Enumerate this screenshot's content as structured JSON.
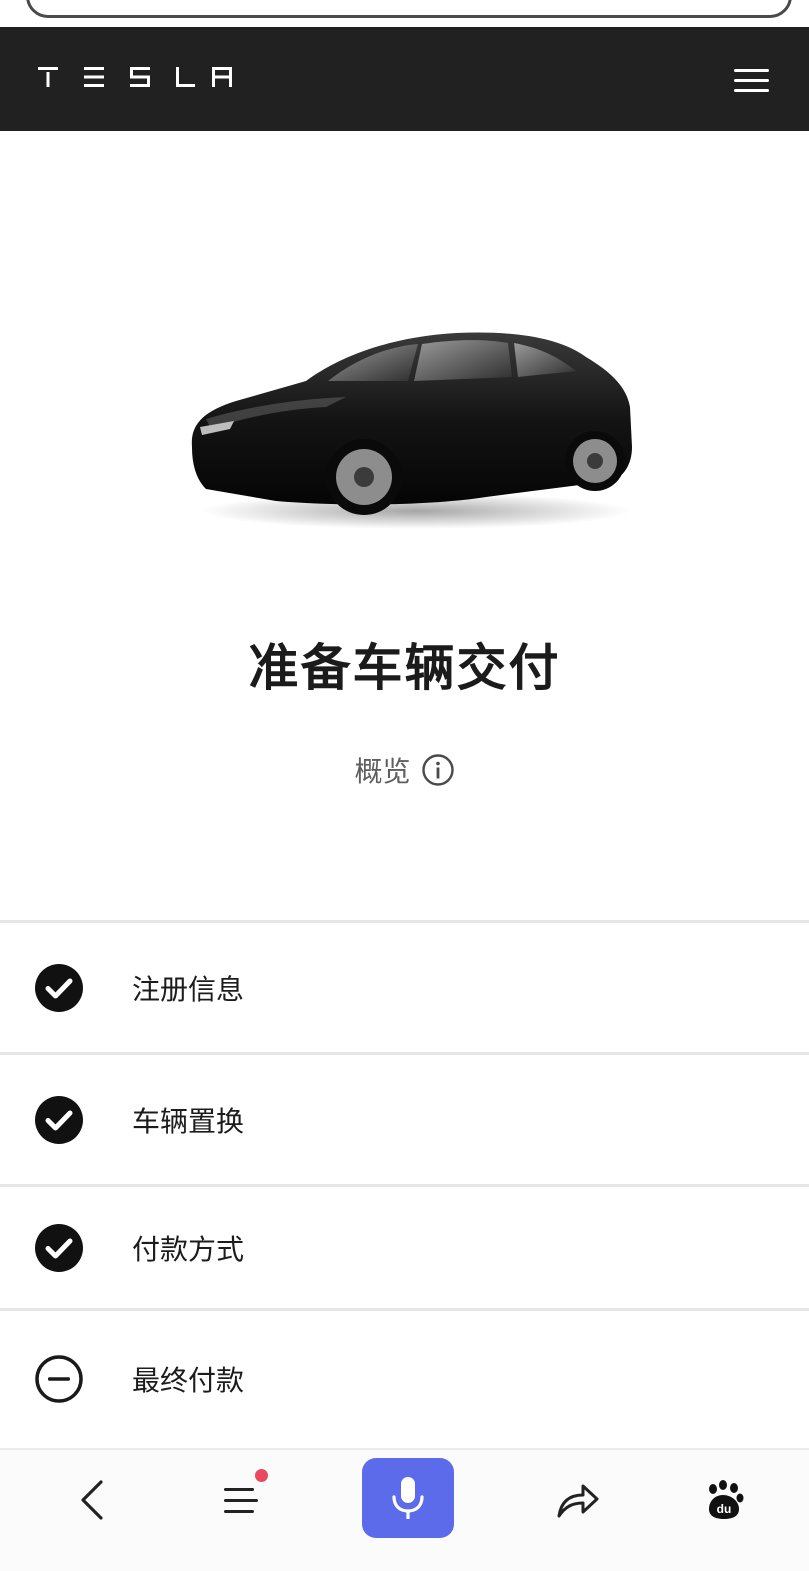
{
  "header": {
    "brand": "TESLA",
    "menu_icon": "hamburger-menu-icon"
  },
  "hero": {
    "vehicle_image": "Model Y black",
    "title": "准备车辆交付",
    "overview_label": "概览",
    "overview_icon": "info-icon"
  },
  "steps": [
    {
      "label": "注册信息",
      "status": "completed",
      "icon": "check-circle-icon"
    },
    {
      "label": "车辆置换",
      "status": "completed",
      "icon": "check-circle-icon"
    },
    {
      "label": "付款方式",
      "status": "completed",
      "icon": "check-circle-icon"
    },
    {
      "label": "最终付款",
      "status": "pending",
      "icon": "minus-circle-icon"
    }
  ],
  "browser_nav": {
    "items": [
      {
        "name": "back",
        "icon": "chevron-left-icon"
      },
      {
        "name": "tabs",
        "icon": "menu-lines-icon",
        "has_notification": true
      },
      {
        "name": "voice",
        "icon": "microphone-icon"
      },
      {
        "name": "share",
        "icon": "share-arrow-icon"
      },
      {
        "name": "baidu",
        "icon": "baidu-paw-icon"
      }
    ]
  },
  "colors": {
    "header_bg": "#212121",
    "mic_button": "#5b6bea",
    "notification_dot": "#e84a5f",
    "divider": "#e6e6e6"
  }
}
